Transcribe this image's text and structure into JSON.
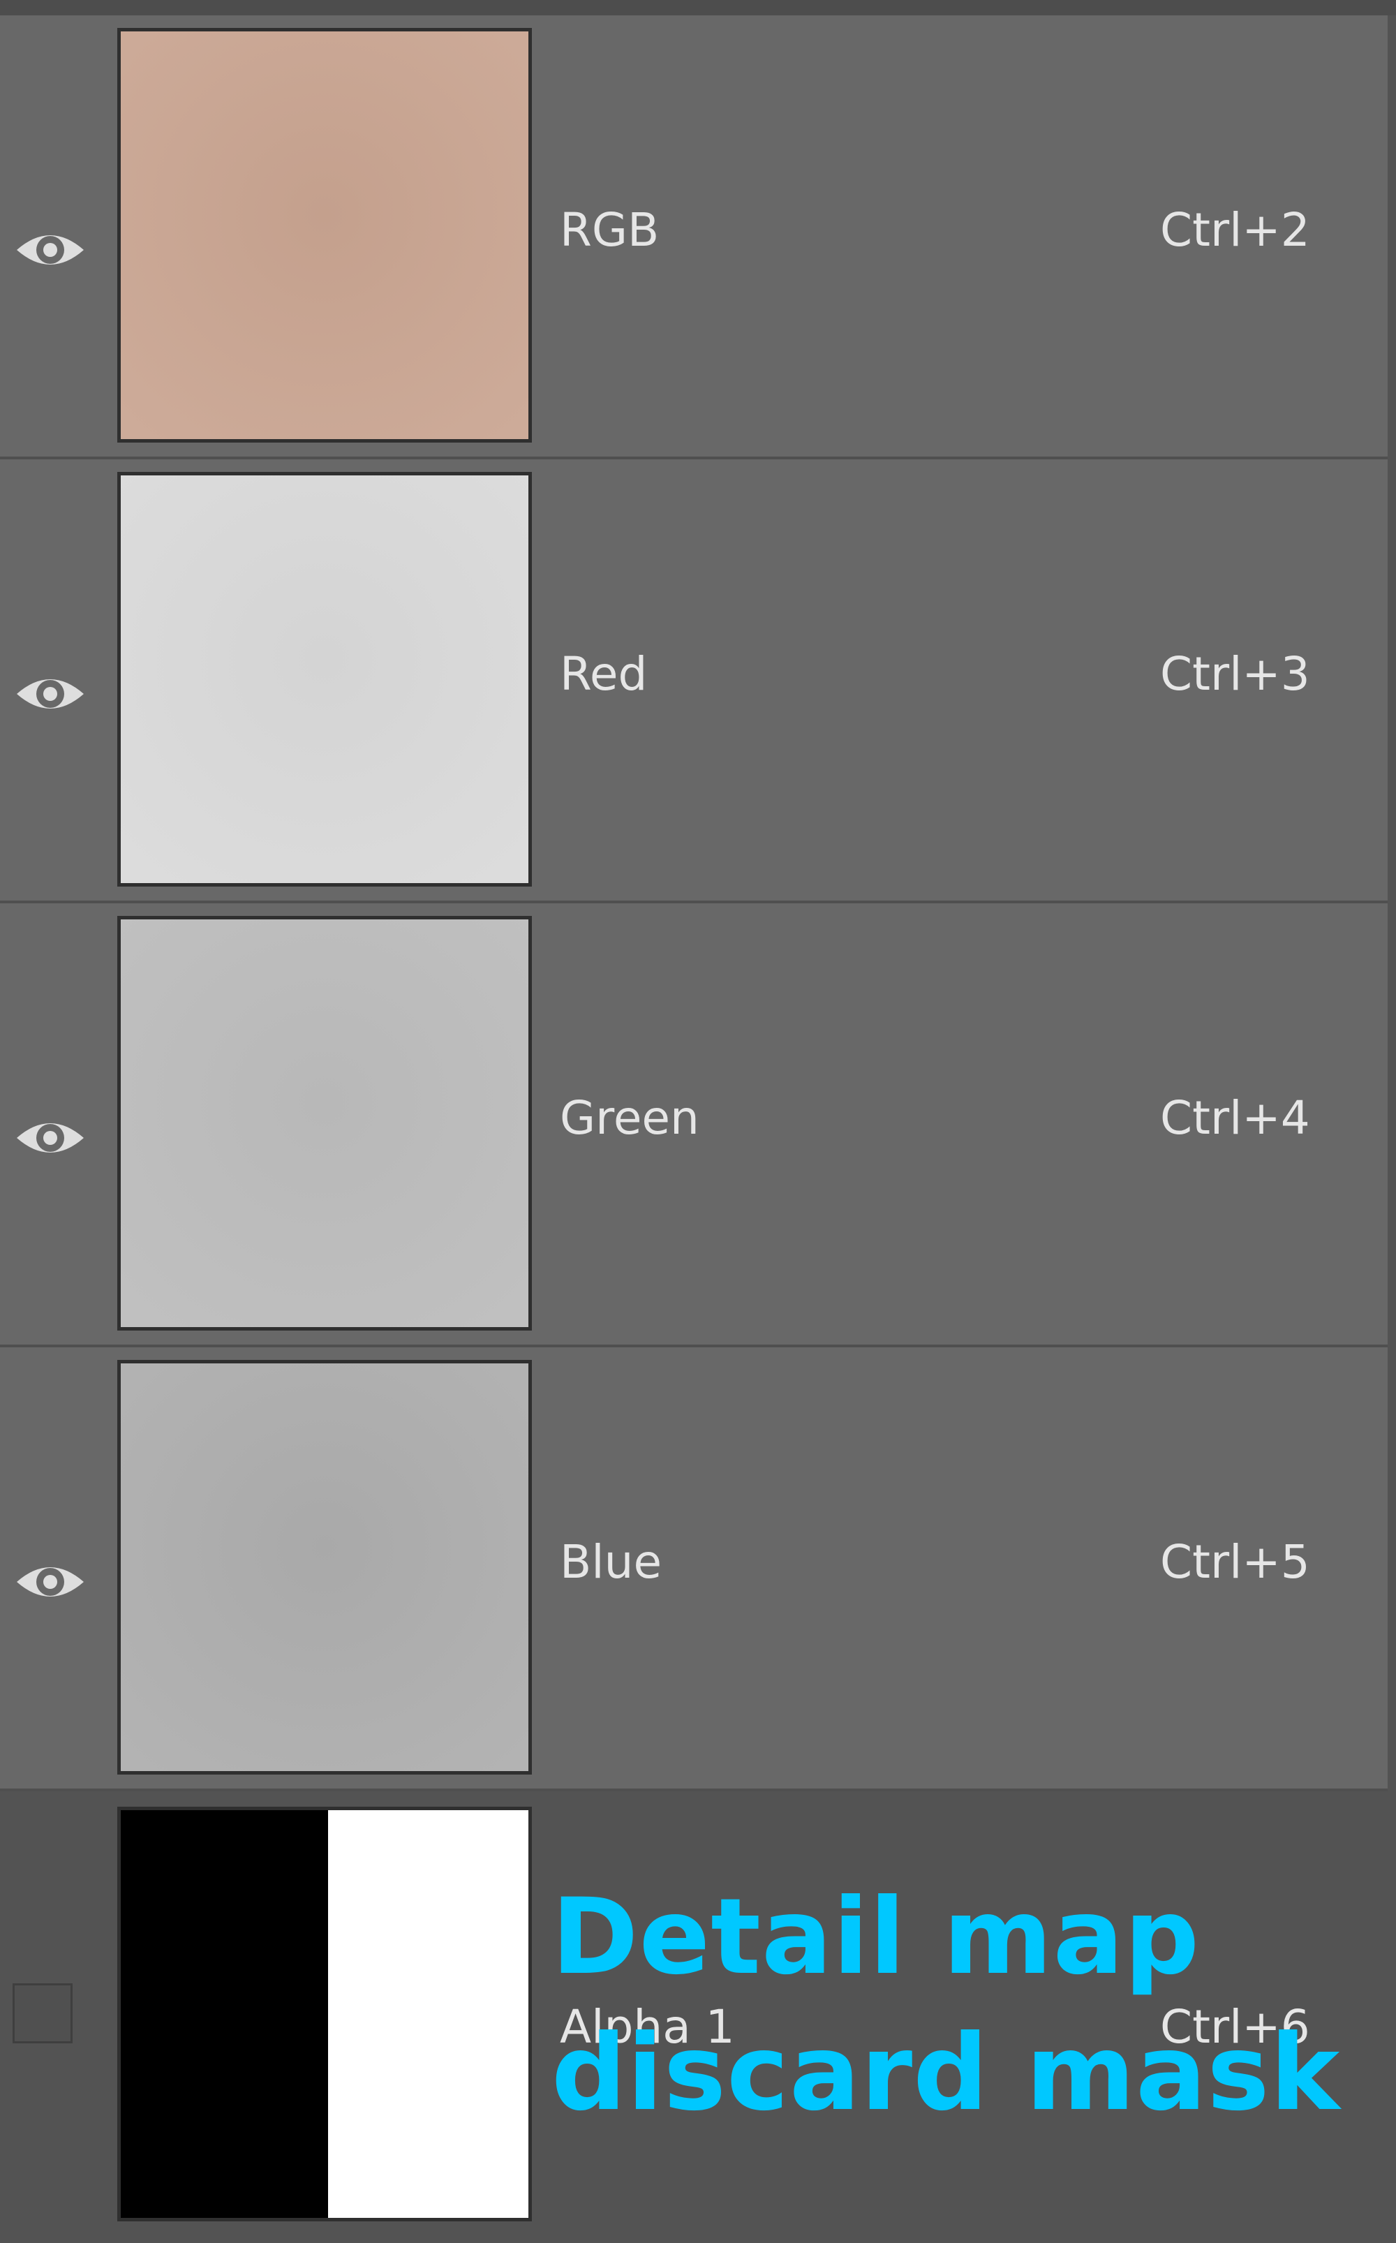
{
  "channels": [
    {
      "name": "RGB",
      "shortcut": "Ctrl+2",
      "visible": true,
      "thumb_color": "#c9a592"
    },
    {
      "name": "Red",
      "shortcut": "Ctrl+3",
      "visible": true,
      "thumb_color": "#d9d9d9"
    },
    {
      "name": "Green",
      "shortcut": "Ctrl+4",
      "visible": true,
      "thumb_color": "#bcbcbc"
    },
    {
      "name": "Blue",
      "shortcut": "Ctrl+5",
      "visible": true,
      "thumb_color": "#aeaeae"
    },
    {
      "name": "Alpha 1",
      "shortcut": "Ctrl+6",
      "visible": false,
      "thumb_colors": [
        "#000000",
        "#ffffff"
      ]
    }
  ],
  "annotation": {
    "line1": "Detail map",
    "line2": "discard mask",
    "color": "#00c8ff"
  }
}
